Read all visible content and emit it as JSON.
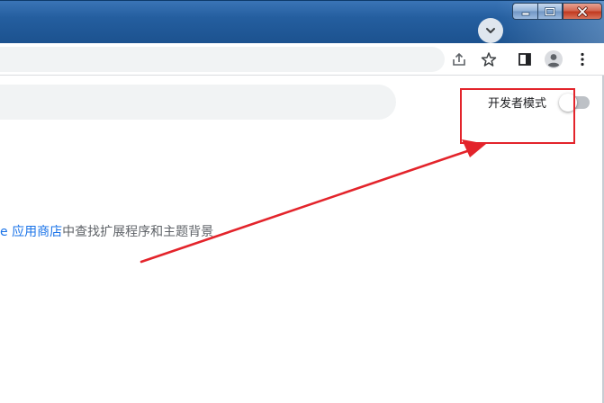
{
  "window": {
    "controls": {
      "minimize": "minimize",
      "maximize": "maximize",
      "close": "close"
    }
  },
  "extensions_page": {
    "developer_mode_label": "开发者模式",
    "developer_mode_enabled": false,
    "store_line": {
      "link_text": "e 应用商店",
      "rest_text": "中查找扩展程序和主题背景"
    }
  },
  "icons": {
    "tab_search": "chevron-down-icon",
    "share": "share-icon",
    "bookmark": "star-icon",
    "side_panel": "side-panel-icon",
    "profile": "profile-icon",
    "menu": "kebab-menu-icon"
  },
  "colors": {
    "titlebar": "#245e9f",
    "annotation": "#e3242b",
    "link": "#1a73e8",
    "toggle_track": "#bdc1c6"
  }
}
